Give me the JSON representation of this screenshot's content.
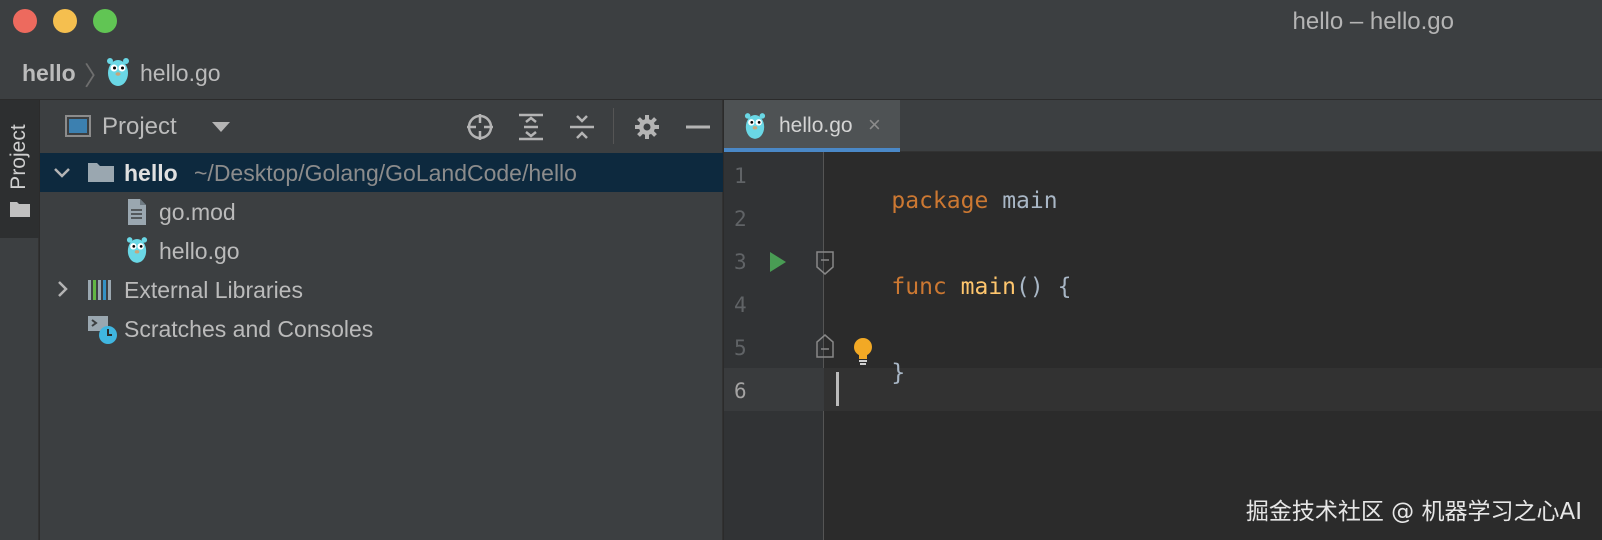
{
  "window": {
    "title": "hello – hello.go",
    "traffic_lights": [
      "close",
      "minimize",
      "maximize"
    ],
    "colors": {
      "close": "#ed6a5e",
      "minimize": "#f5bf4f",
      "maximize": "#61c554"
    }
  },
  "breadcrumb": {
    "root": "hello",
    "separator": "〉",
    "file": "hello.go",
    "file_icon": "gopher-icon"
  },
  "tool_strip": {
    "project_tab": "Project",
    "folder_icon": "folder-icon"
  },
  "project_panel": {
    "title": "Project",
    "header_icons": [
      "locate-icon",
      "expand-all-icon",
      "collapse-all-icon",
      "gear-icon",
      "hide-icon"
    ],
    "tree": [
      {
        "label": "hello",
        "path": "~/Desktop/Golang/GoLandCode/hello",
        "icon": "folder-icon",
        "expanded": true,
        "selected": true
      },
      {
        "label": "go.mod",
        "icon": "file-icon"
      },
      {
        "label": "hello.go",
        "icon": "gopher-icon"
      },
      {
        "label": "External Libraries",
        "icon": "libraries-icon",
        "expanded": false
      },
      {
        "label": "Scratches and Consoles",
        "icon": "scratches-icon"
      }
    ]
  },
  "editor": {
    "tab": {
      "label": "hello.go",
      "close": "×",
      "icon": "gopher-icon"
    },
    "line_numbers": [
      "1",
      "2",
      "3",
      "4",
      "5",
      "6"
    ],
    "current_line": "6",
    "lines": {
      "l1_kw": "package",
      "l1_id": "main",
      "l3_kw": "func",
      "l3_fn": "main",
      "l3_rest": "() {",
      "l5": "}"
    },
    "syntax_colors": {
      "keyword": "#cc7832",
      "identifier": "#a9b7c6",
      "function": "#ffc66d"
    }
  },
  "watermark": "掘金技术社区 @ 机器学习之心AI"
}
